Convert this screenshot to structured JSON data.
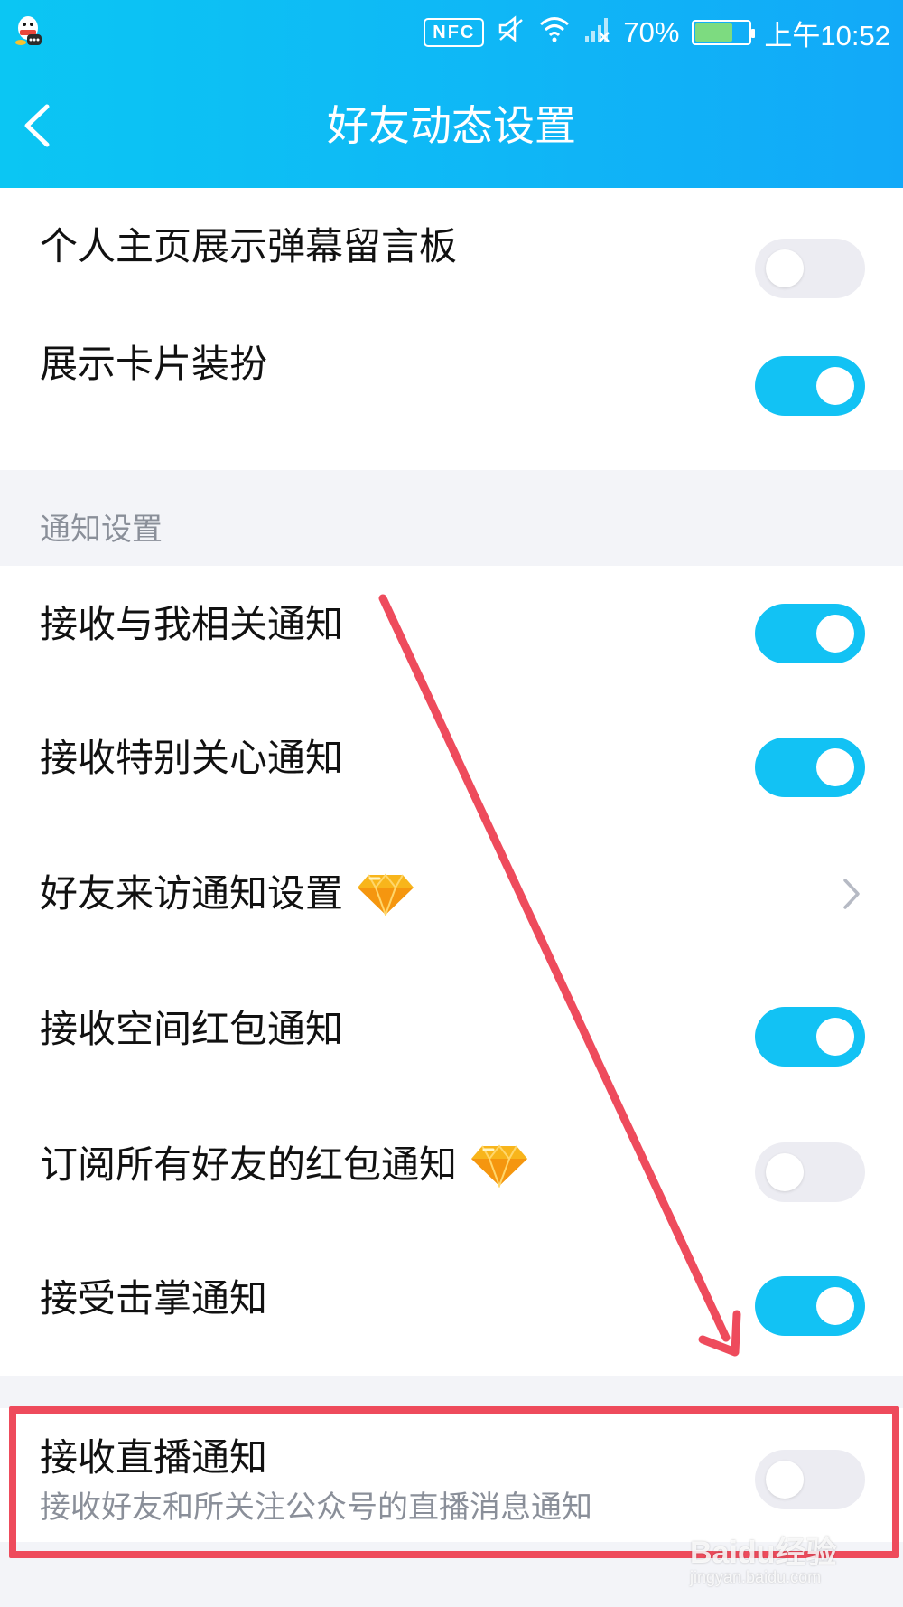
{
  "status_bar": {
    "nfc": "NFC",
    "battery": "70%",
    "battery_level": 0.7,
    "time": "上午10:52"
  },
  "header": {
    "title": "好友动态设置",
    "back_icon": "chevron-left-icon"
  },
  "top_group": [
    {
      "label": "个人主页展示弹幕留言板",
      "toggle": false
    },
    {
      "label": "展示卡片装扮",
      "toggle": true
    }
  ],
  "notify_section": {
    "title": "通知设置",
    "items": [
      {
        "label": "接收与我相关通知",
        "toggle": true
      },
      {
        "label": "接收特别关心通知",
        "toggle": true
      },
      {
        "label": "好友来访通知设置",
        "type": "link",
        "badge": "diamond-icon"
      },
      {
        "label": "接收空间红包通知",
        "toggle": true
      },
      {
        "label": "订阅所有好友的红包通知",
        "toggle": false,
        "badge": "diamond-icon"
      },
      {
        "label": "接受击掌通知",
        "toggle": true
      }
    ]
  },
  "live_group": {
    "label": "接收直播通知",
    "sublabel": "接收好友和所关注公众号的直播消息通知",
    "toggle": false
  },
  "watermark": {
    "line1": "Baidu经验",
    "line2": "jingyan.baidu.com"
  },
  "colors": {
    "header_start": "#0bc6f3",
    "header_end": "#12a9f8",
    "toggle_on": "#12c2f4",
    "toggle_off": "#ececf2",
    "annotation": "#ee4b5c",
    "background": "#f3f4f8"
  }
}
